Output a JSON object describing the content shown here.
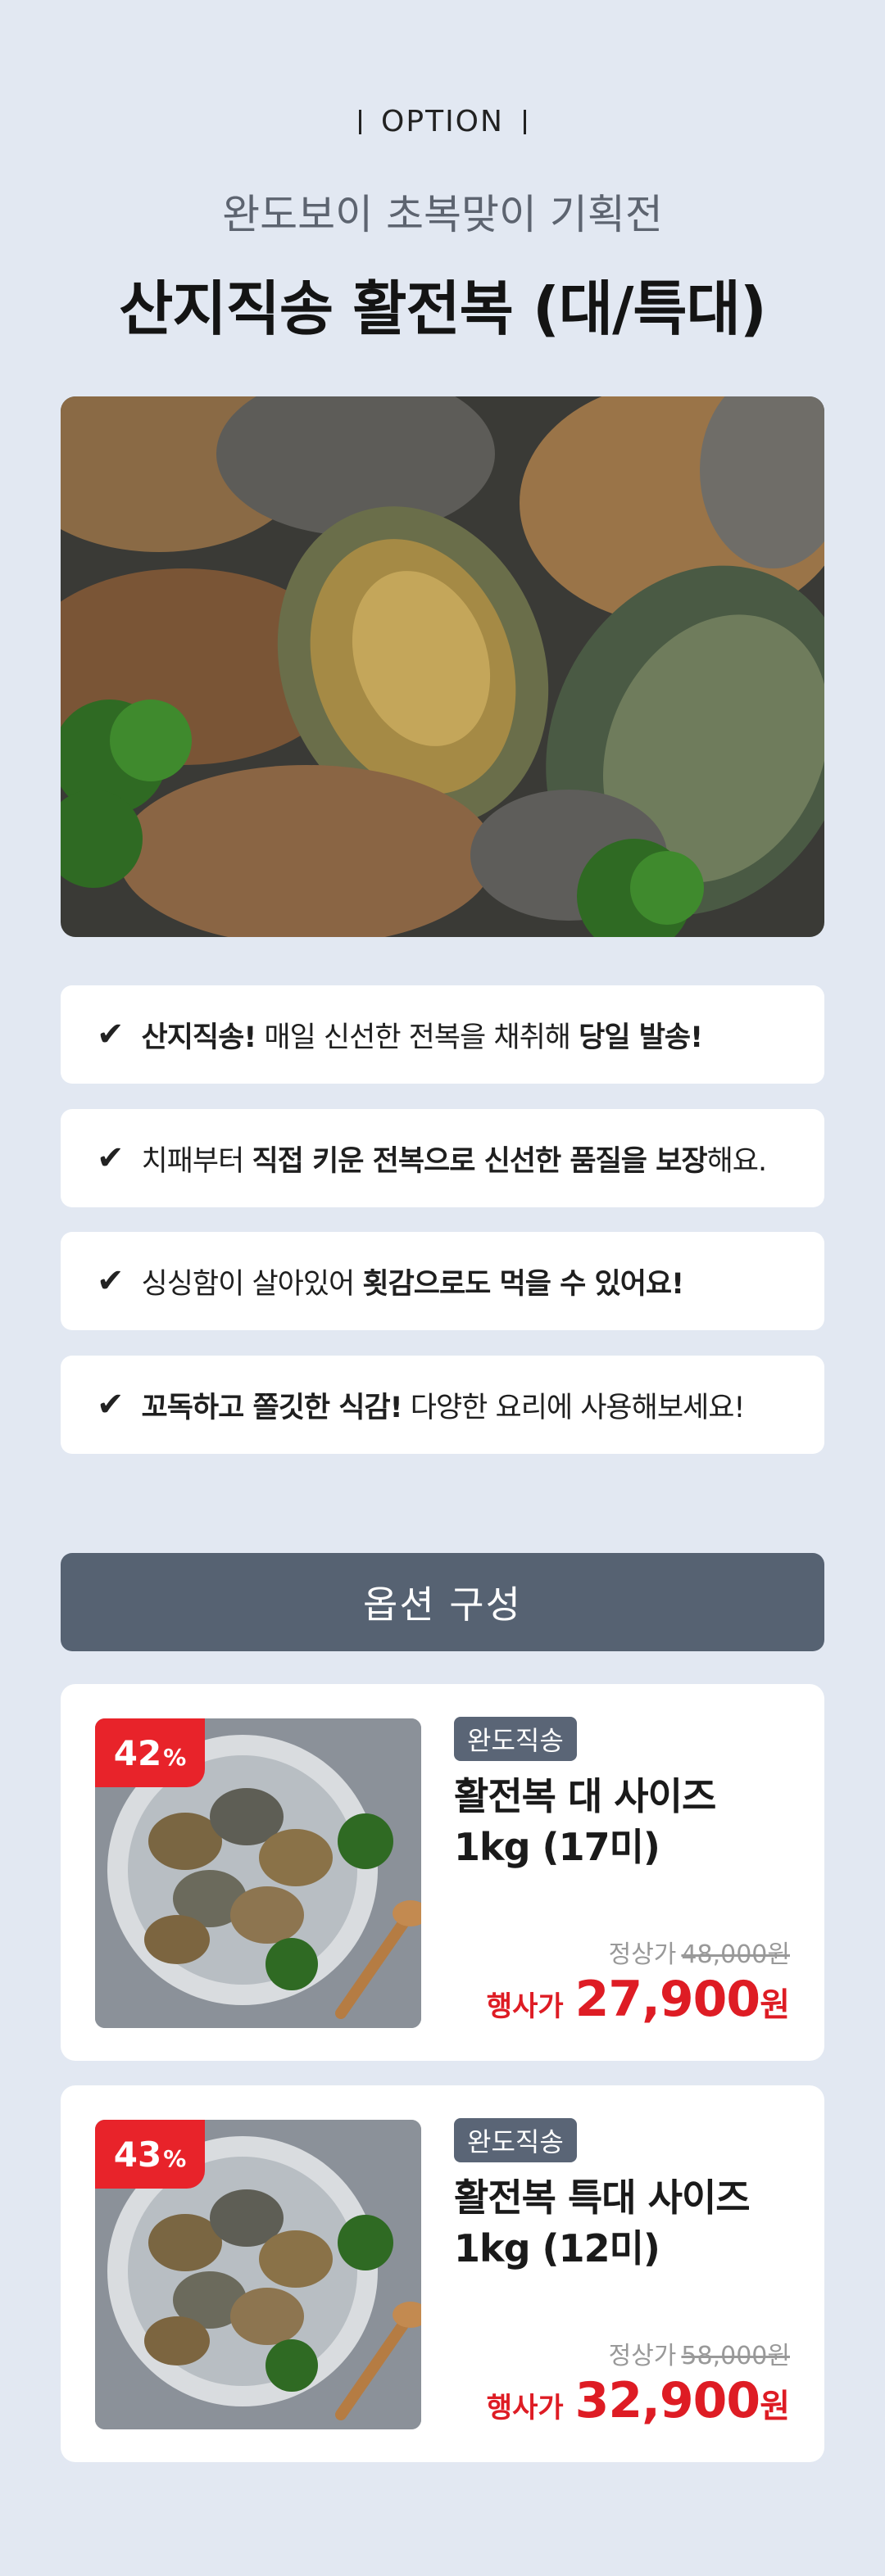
{
  "header": {
    "tag": "OPTION",
    "subtitle": "완도보이 초복맞이 기획전",
    "title": "산지직송 활전복 (대/특대)"
  },
  "features": [
    {
      "check": "✔",
      "p1b": "산지직송!",
      "p2": " 매일 신선한 전복을 채취해 ",
      "p3b": "당일 발송!",
      "p4": ""
    },
    {
      "check": "✔",
      "p1b": "",
      "p2": "치패부터 ",
      "p3b": "직접 키운 전복으로 신선한 품질을 보장",
      "p4": "해요."
    },
    {
      "check": "✔",
      "p1b": "",
      "p2": "싱싱함이 살아있어 ",
      "p3b": "횟감으로도 먹을 수 있어요!",
      "p4": ""
    },
    {
      "check": "✔",
      "p1b": "꼬독하고 쫄깃한 식감!",
      "p2": " 다양한 요리에 사용해보세요!",
      "p3b": "",
      "p4": ""
    }
  ],
  "options_header": "옵션 구성",
  "products": [
    {
      "discount": "42",
      "discount_unit": "%",
      "badge": "완도직송",
      "name_line1": "활전복 대 사이즈",
      "name_line2": "1kg (17미)",
      "orig_label": "정상가",
      "orig_price": "48,000원",
      "sale_label": "행사가",
      "sale_price": "27,900",
      "sale_unit": "원"
    },
    {
      "discount": "43",
      "discount_unit": "%",
      "badge": "완도직송",
      "name_line1": "활전복 특대 사이즈",
      "name_line2": "1kg (12미)",
      "orig_label": "정상가",
      "orig_price": "58,000원",
      "sale_label": "행사가",
      "sale_price": "32,900",
      "sale_unit": "원"
    }
  ],
  "colors": {
    "background": "#e2e8f2",
    "section_header": "#566272",
    "discount_badge": "#e8232a",
    "sale_price": "#de1c24",
    "product_badge": "#5a6576"
  }
}
